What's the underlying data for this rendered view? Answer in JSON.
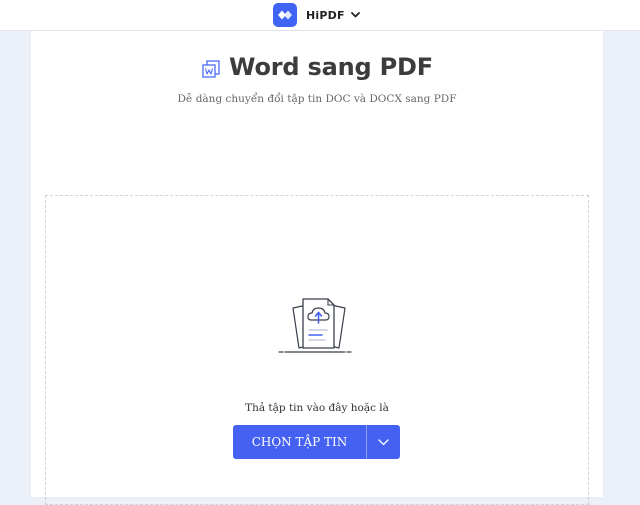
{
  "header": {
    "brand_name": "HiPDF",
    "logo_icon": "hipdf-logo-icon",
    "menu_icon": "chevron-down-icon"
  },
  "main": {
    "title": "Word sang PDF",
    "title_icon": "word-file-icon",
    "subtitle": "Dễ dàng chuyển đổi tập tin DOC và DOCX sang PDF"
  },
  "upload": {
    "illustration": "cloud-upload-icon",
    "drop_hint": "Thả tập tin vào đây hoặc là",
    "choose_label": "CHỌN TẬP TIN",
    "dropdown_icon": "chevron-down-icon"
  },
  "colors": {
    "accent": "#4461f2",
    "page_background": "#ecf0f9",
    "title_text": "#3c3c3c"
  }
}
